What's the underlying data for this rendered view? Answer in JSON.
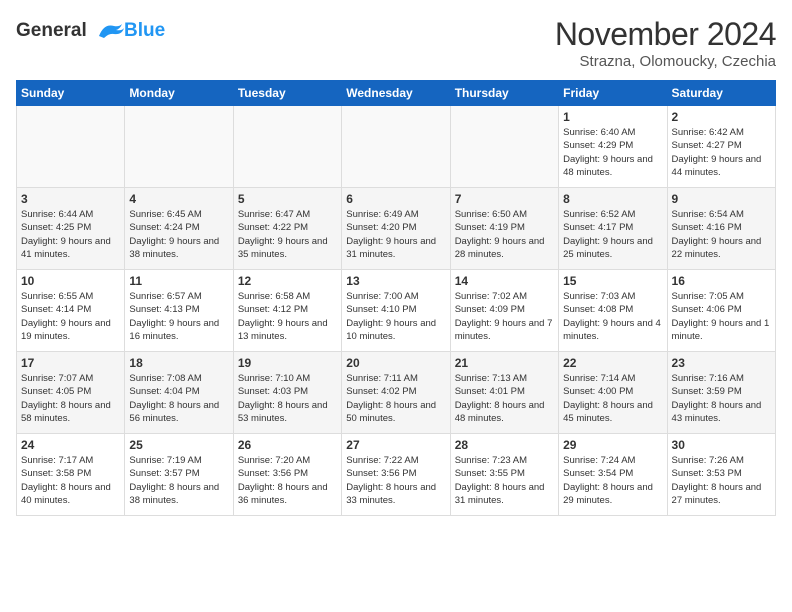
{
  "header": {
    "logo_line1": "General",
    "logo_line2": "Blue",
    "month_title": "November 2024",
    "location": "Strazna, Olomoucky, Czechia"
  },
  "weekdays": [
    "Sunday",
    "Monday",
    "Tuesday",
    "Wednesday",
    "Thursday",
    "Friday",
    "Saturday"
  ],
  "weeks": [
    [
      {
        "day": "",
        "empty": true
      },
      {
        "day": "",
        "empty": true
      },
      {
        "day": "",
        "empty": true
      },
      {
        "day": "",
        "empty": true
      },
      {
        "day": "",
        "empty": true
      },
      {
        "day": "1",
        "sunrise": "Sunrise: 6:40 AM",
        "sunset": "Sunset: 4:29 PM",
        "daylight": "Daylight: 9 hours and 48 minutes."
      },
      {
        "day": "2",
        "sunrise": "Sunrise: 6:42 AM",
        "sunset": "Sunset: 4:27 PM",
        "daylight": "Daylight: 9 hours and 44 minutes."
      }
    ],
    [
      {
        "day": "3",
        "sunrise": "Sunrise: 6:44 AM",
        "sunset": "Sunset: 4:25 PM",
        "daylight": "Daylight: 9 hours and 41 minutes."
      },
      {
        "day": "4",
        "sunrise": "Sunrise: 6:45 AM",
        "sunset": "Sunset: 4:24 PM",
        "daylight": "Daylight: 9 hours and 38 minutes."
      },
      {
        "day": "5",
        "sunrise": "Sunrise: 6:47 AM",
        "sunset": "Sunset: 4:22 PM",
        "daylight": "Daylight: 9 hours and 35 minutes."
      },
      {
        "day": "6",
        "sunrise": "Sunrise: 6:49 AM",
        "sunset": "Sunset: 4:20 PM",
        "daylight": "Daylight: 9 hours and 31 minutes."
      },
      {
        "day": "7",
        "sunrise": "Sunrise: 6:50 AM",
        "sunset": "Sunset: 4:19 PM",
        "daylight": "Daylight: 9 hours and 28 minutes."
      },
      {
        "day": "8",
        "sunrise": "Sunrise: 6:52 AM",
        "sunset": "Sunset: 4:17 PM",
        "daylight": "Daylight: 9 hours and 25 minutes."
      },
      {
        "day": "9",
        "sunrise": "Sunrise: 6:54 AM",
        "sunset": "Sunset: 4:16 PM",
        "daylight": "Daylight: 9 hours and 22 minutes."
      }
    ],
    [
      {
        "day": "10",
        "sunrise": "Sunrise: 6:55 AM",
        "sunset": "Sunset: 4:14 PM",
        "daylight": "Daylight: 9 hours and 19 minutes."
      },
      {
        "day": "11",
        "sunrise": "Sunrise: 6:57 AM",
        "sunset": "Sunset: 4:13 PM",
        "daylight": "Daylight: 9 hours and 16 minutes."
      },
      {
        "day": "12",
        "sunrise": "Sunrise: 6:58 AM",
        "sunset": "Sunset: 4:12 PM",
        "daylight": "Daylight: 9 hours and 13 minutes."
      },
      {
        "day": "13",
        "sunrise": "Sunrise: 7:00 AM",
        "sunset": "Sunset: 4:10 PM",
        "daylight": "Daylight: 9 hours and 10 minutes."
      },
      {
        "day": "14",
        "sunrise": "Sunrise: 7:02 AM",
        "sunset": "Sunset: 4:09 PM",
        "daylight": "Daylight: 9 hours and 7 minutes."
      },
      {
        "day": "15",
        "sunrise": "Sunrise: 7:03 AM",
        "sunset": "Sunset: 4:08 PM",
        "daylight": "Daylight: 9 hours and 4 minutes."
      },
      {
        "day": "16",
        "sunrise": "Sunrise: 7:05 AM",
        "sunset": "Sunset: 4:06 PM",
        "daylight": "Daylight: 9 hours and 1 minute."
      }
    ],
    [
      {
        "day": "17",
        "sunrise": "Sunrise: 7:07 AM",
        "sunset": "Sunset: 4:05 PM",
        "daylight": "Daylight: 8 hours and 58 minutes."
      },
      {
        "day": "18",
        "sunrise": "Sunrise: 7:08 AM",
        "sunset": "Sunset: 4:04 PM",
        "daylight": "Daylight: 8 hours and 56 minutes."
      },
      {
        "day": "19",
        "sunrise": "Sunrise: 7:10 AM",
        "sunset": "Sunset: 4:03 PM",
        "daylight": "Daylight: 8 hours and 53 minutes."
      },
      {
        "day": "20",
        "sunrise": "Sunrise: 7:11 AM",
        "sunset": "Sunset: 4:02 PM",
        "daylight": "Daylight: 8 hours and 50 minutes."
      },
      {
        "day": "21",
        "sunrise": "Sunrise: 7:13 AM",
        "sunset": "Sunset: 4:01 PM",
        "daylight": "Daylight: 8 hours and 48 minutes."
      },
      {
        "day": "22",
        "sunrise": "Sunrise: 7:14 AM",
        "sunset": "Sunset: 4:00 PM",
        "daylight": "Daylight: 8 hours and 45 minutes."
      },
      {
        "day": "23",
        "sunrise": "Sunrise: 7:16 AM",
        "sunset": "Sunset: 3:59 PM",
        "daylight": "Daylight: 8 hours and 43 minutes."
      }
    ],
    [
      {
        "day": "24",
        "sunrise": "Sunrise: 7:17 AM",
        "sunset": "Sunset: 3:58 PM",
        "daylight": "Daylight: 8 hours and 40 minutes."
      },
      {
        "day": "25",
        "sunrise": "Sunrise: 7:19 AM",
        "sunset": "Sunset: 3:57 PM",
        "daylight": "Daylight: 8 hours and 38 minutes."
      },
      {
        "day": "26",
        "sunrise": "Sunrise: 7:20 AM",
        "sunset": "Sunset: 3:56 PM",
        "daylight": "Daylight: 8 hours and 36 minutes."
      },
      {
        "day": "27",
        "sunrise": "Sunrise: 7:22 AM",
        "sunset": "Sunset: 3:56 PM",
        "daylight": "Daylight: 8 hours and 33 minutes."
      },
      {
        "day": "28",
        "sunrise": "Sunrise: 7:23 AM",
        "sunset": "Sunset: 3:55 PM",
        "daylight": "Daylight: 8 hours and 31 minutes."
      },
      {
        "day": "29",
        "sunrise": "Sunrise: 7:24 AM",
        "sunset": "Sunset: 3:54 PM",
        "daylight": "Daylight: 8 hours and 29 minutes."
      },
      {
        "day": "30",
        "sunrise": "Sunrise: 7:26 AM",
        "sunset": "Sunset: 3:53 PM",
        "daylight": "Daylight: 8 hours and 27 minutes."
      }
    ]
  ]
}
